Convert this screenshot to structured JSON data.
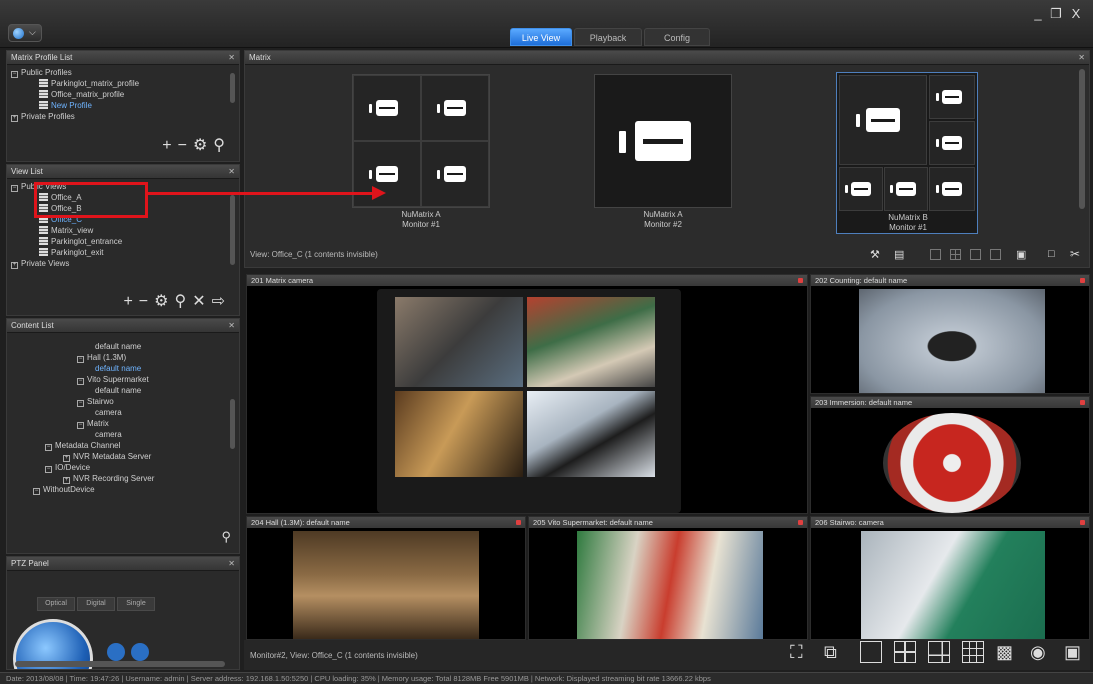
{
  "window": {
    "tabs": [
      "Live View",
      "Playback",
      "Config"
    ],
    "active_tab": "Live View",
    "controls": [
      "_",
      "д",
      "X"
    ]
  },
  "matrix_profile_list": {
    "title": "Matrix Profile List",
    "items": [
      "Public Profiles",
      "Parkinglot_matrix_profile",
      "Office_matrix_profile",
      "New Profile",
      "Private Profiles"
    ]
  },
  "view_list": {
    "title": "View List",
    "items": [
      "Public Views",
      "Office_A",
      "Office_B",
      "Office_C",
      "Matrix_view",
      "Parkinglot_entrance",
      "Parkinglot_exit",
      "Private Views"
    ],
    "highlighted": "Office_A"
  },
  "content_list": {
    "title": "Content List",
    "items": [
      "default name",
      "Hall (1.3M)",
      "default name",
      "Vito Supermarket",
      "default name",
      "Stairwo",
      "camera",
      "Matrix",
      "camera",
      "Metadata Channel",
      "NVR Metadata Server",
      "IO/Device",
      "NVR Recording Server",
      "WithoutDevice"
    ]
  },
  "ptz_panel": {
    "title": "PTZ Panel",
    "tabs": [
      "Optical",
      "Digital",
      "Single"
    ]
  },
  "matrix": {
    "title": "Matrix",
    "monitors": [
      {
        "line1": "NuMatrix A",
        "line2": "Monitor #1"
      },
      {
        "line1": "NuMatrix A",
        "line2": "Monitor #2"
      },
      {
        "line1": "NuMatrix B",
        "line2": "Monitor #1"
      }
    ],
    "view_info": "View: Office_C (1 contents invisible)"
  },
  "cameras": [
    {
      "label": "201 Matrix camera"
    },
    {
      "label": "202 Counting: default name"
    },
    {
      "label": "203 Immersion: default name"
    },
    {
      "label": "204 Hall (1.3M): default name"
    },
    {
      "label": "205 Vito Supermarket: default name"
    },
    {
      "label": "206 Stairwo: camera"
    }
  ],
  "bottom_bar": {
    "info": "Monitor#2, View: Office_C (1 contents invisible)"
  },
  "status_bar": {
    "text": "Date: 2013/08/08 | Time: 19:47:26 | Username: admin | Server address: 192.168.1.50:5250 | CPU loading: 35% | Memory usage: Total 8128MB Free 5901MB | Network: Displayed streaming bit rate 13666.22 kbps"
  },
  "colors": {
    "accent": "#1e6ed8",
    "highlight": "#e0141b",
    "selected_text": "#6fb4ff"
  }
}
